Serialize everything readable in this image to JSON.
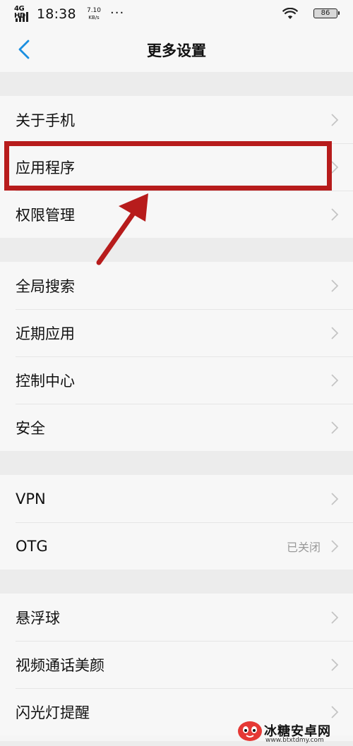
{
  "status_bar": {
    "network": "4G HD",
    "time": "18:38",
    "speed_value": "7.10",
    "speed_unit": "KB/s",
    "more": "···",
    "battery": "86"
  },
  "header": {
    "title": "更多设置"
  },
  "groups": [
    {
      "items": [
        {
          "label": "关于手机",
          "value": ""
        },
        {
          "label": "应用程序",
          "value": ""
        },
        {
          "label": "权限管理",
          "value": ""
        }
      ]
    },
    {
      "items": [
        {
          "label": "全局搜索",
          "value": ""
        },
        {
          "label": "近期应用",
          "value": ""
        },
        {
          "label": "控制中心",
          "value": ""
        },
        {
          "label": "安全",
          "value": ""
        }
      ]
    },
    {
      "items": [
        {
          "label": "VPN",
          "value": ""
        },
        {
          "label": "OTG",
          "value": "已关闭"
        }
      ]
    },
    {
      "items": [
        {
          "label": "悬浮球",
          "value": ""
        },
        {
          "label": "视频通话美颜",
          "value": ""
        },
        {
          "label": "闪光灯提醒",
          "value": ""
        }
      ]
    }
  ],
  "watermark": {
    "name": "冰糖安卓网",
    "url": "www.btxtdmy.com"
  },
  "colors": {
    "accent": "#1a8fe0",
    "annotation": "#b71c1c"
  }
}
